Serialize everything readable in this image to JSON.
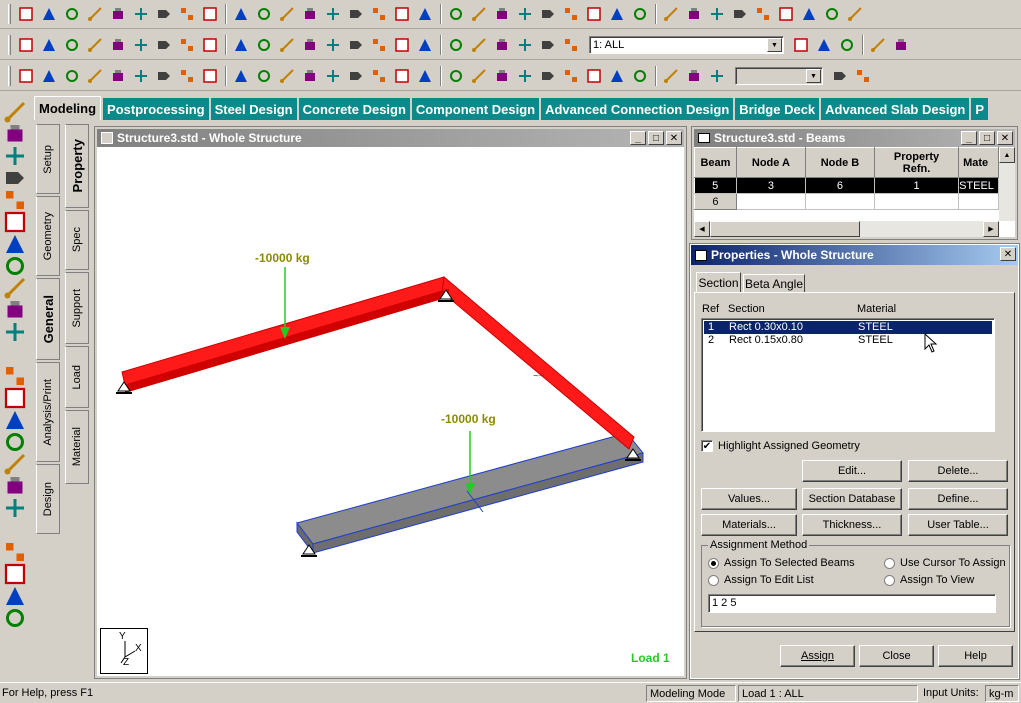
{
  "toolbar_row1": {
    "icons": [
      "new-file-icon",
      "open-icon",
      "open-folder-icon",
      "save-icon",
      "copy-icon",
      "cut-icon",
      "paste-icon",
      "delete-icon",
      "undo-icon",
      "undo-list-icon",
      "redo-icon",
      "redo-list-icon",
      "wizard-icon",
      "page-icon",
      "page-setup-icon",
      "structure-icon",
      "hammer-icon",
      "print-icon",
      "print-preview-icon",
      "printer-icon",
      "camera-icon",
      "take-picture-icon",
      "report-icon",
      "report-setup-icon",
      "window-icon",
      "dimension-icon",
      "distance-icon",
      "angle-icon",
      "node-icon",
      "beam-icon",
      "beam-span-icon",
      "stop-icon",
      "help-icon",
      "check-icon",
      "export-icon",
      "close-mdi-icon"
    ]
  },
  "toolbar_row2": {
    "icons": [
      "iso-view-icon",
      "front-view-icon",
      "back-view-icon",
      "left-view-icon",
      "right-view-icon",
      "top-view-icon",
      "bottom-view-icon",
      "rotate-up-icon",
      "rotate-down-icon",
      "rotate-left-icon",
      "rotate-right-icon",
      "spin-left-icon",
      "spin-right-icon",
      "pan-icon",
      "zoom-window-icon",
      "zoom-in-icon",
      "zoom-out-icon",
      "zoom-dynamic-icon",
      "zoom-all-icon",
      "previous-view-icon",
      "zoom-extents-icon",
      "magnify-icon",
      "symbols-icon",
      "select-cursor-icon",
      "help-toggle-icon",
      "beam-cursor-icon",
      "support-cursor-icon",
      "member-query-icon",
      "color-icon"
    ],
    "view_combo": "1: ALL"
  },
  "toolbar_row3": {
    "icons": [
      "snap-node-icon",
      "snap-beam-icon",
      "add-node-icon",
      "add-beam-icon",
      "add-plate-icon",
      "add-solid-icon",
      "add-surface-icon",
      "plate-grid-icon",
      "create-grid-icon",
      "add-link-icon",
      "cut-icon-2",
      "translational-repeat-icon",
      "circular-repeat-icon",
      "rotate-icon",
      "mirror-icon",
      "move-icon",
      "grid-icon",
      "insert-node-icon",
      "load-fx-icon",
      "load-fy-icon",
      "load-fz-icon",
      "moment-mx-icon",
      "moment-my-icon",
      "moment-mz-icon",
      "load-a-icon",
      "load-b-icon",
      "load-c-icon",
      "load-d-icon",
      "load-e-icon",
      "load-f-icon",
      "display-icon",
      "help-context-icon"
    ],
    "disabled_combo": ""
  },
  "page_tabs": [
    {
      "label": "Modeling",
      "active": true
    },
    {
      "label": "Postprocessing",
      "active": false
    },
    {
      "label": "Steel Design",
      "active": false
    },
    {
      "label": "Concrete Design",
      "active": false
    },
    {
      "label": "Component Design",
      "active": false
    },
    {
      "label": "Advanced Connection Design",
      "active": false
    },
    {
      "label": "Bridge Deck",
      "active": false
    },
    {
      "label": "Advanced Slab Design",
      "active": false
    },
    {
      "label": "P",
      "active": false
    }
  ],
  "outer_vtabs": [
    {
      "label": "Setup",
      "active": false
    },
    {
      "label": "Geometry",
      "active": false
    },
    {
      "label": "General",
      "active": true
    },
    {
      "label": "Analysis/Print",
      "active": false
    },
    {
      "label": "Design",
      "active": false
    }
  ],
  "inner_vtabs": [
    {
      "label": "Property",
      "active": true
    },
    {
      "label": "Spec",
      "active": false
    },
    {
      "label": "Support",
      "active": false
    },
    {
      "label": "Load",
      "active": false
    },
    {
      "label": "Material",
      "active": false
    }
  ],
  "structure_window": {
    "title": "Structure3.std - Whole Structure",
    "load_label_1": "-10000 kg",
    "load_label_2": "-10000 kg",
    "load_case": "Load 1",
    "axis_y": "Y",
    "axis_x": "X",
    "axis_z": "Z"
  },
  "beams_window": {
    "title": "Structure3.std - Beams",
    "columns": [
      "Beam",
      "Node A",
      "Node B",
      "Property Refn.",
      "Mate"
    ],
    "rows": [
      {
        "beam": "5",
        "node_a": "3",
        "node_b": "6",
        "prop": "1",
        "mat": "STEEL",
        "selected": true
      },
      {
        "beam": "6",
        "node_a": "",
        "node_b": "",
        "prop": "",
        "mat": "",
        "selected": false
      }
    ]
  },
  "properties_window": {
    "title": "Properties - Whole Structure",
    "tabs": [
      "Section",
      "Beta Angle"
    ],
    "list_headers": {
      "ref": "Ref",
      "section": "Section",
      "material": "Material"
    },
    "list_rows": [
      {
        "ref": "1",
        "section": "Rect 0.30x0.10",
        "material": "STEEL",
        "selected": true
      },
      {
        "ref": "2",
        "section": "Rect 0.15x0.80",
        "material": "STEEL",
        "selected": false
      }
    ],
    "highlight_label": "Highlight Assigned Geometry",
    "buttons": {
      "edit": "Edit...",
      "delete": "Delete...",
      "values": "Values...",
      "section_db": "Section Database",
      "define": "Define...",
      "materials": "Materials...",
      "thickness": "Thickness...",
      "user_table": "User Table..."
    },
    "assign_group_label": "Assignment Method",
    "assign_options": {
      "selected_beams": "Assign To Selected Beams",
      "cursor": "Use Cursor To Assign",
      "edit_list": "Assign To Edit List",
      "view": "Assign To View"
    },
    "edit_list_value": "1 2 5",
    "footer_buttons": {
      "assign": "Assign",
      "close": "Close",
      "help": "Help"
    }
  },
  "statusbar": {
    "help": "For Help, press F1",
    "mode": "Modeling Mode",
    "load": "Load 1 : ALL",
    "units_label": "Input Units:",
    "units": "kg-m"
  },
  "colors": {
    "tab_teal": "#0a8a8a",
    "title_active": "#0a246a",
    "beam_red": "#ff1a1a",
    "slab_gray": "#8c8c8c",
    "load_green": "#22cc22",
    "load_label": "#8b8b00",
    "selection_navy": "#0a246a"
  }
}
